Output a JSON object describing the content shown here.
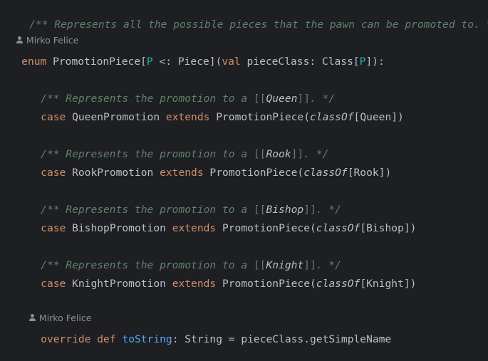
{
  "doc_top": "/** Represents all the possible pieces that the pawn can be promoted to. */",
  "author_1": "Mirko Felice",
  "enum_line": {
    "kw_enum": "enum",
    "name": " PromotionPiece[",
    "tparam": "P",
    "bound": " <: Piece](",
    "kw_val": "val",
    "rest": " pieceClass: Class[",
    "tparam2": "P",
    "end": "]):"
  },
  "cases": [
    {
      "doc_prefix": "/** Represents the promotion to a ",
      "doc_lb": "[[",
      "doc_link": "Queen",
      "doc_rb": "]]",
      "doc_suffix": ". */",
      "kw_case": "case",
      "name": " QueenPromotion ",
      "kw_extends": "extends",
      "parent": " PromotionPiece(",
      "fn": "classOf",
      "arg": "[Queen])"
    },
    {
      "doc_prefix": "/** Represents the promotion to a ",
      "doc_lb": "[[",
      "doc_link": "Rook",
      "doc_rb": "]]",
      "doc_suffix": ". */",
      "kw_case": "case",
      "name": " RookPromotion ",
      "kw_extends": "extends",
      "parent": " PromotionPiece(",
      "fn": "classOf",
      "arg": "[Rook])"
    },
    {
      "doc_prefix": "/** Represents the promotion to a ",
      "doc_lb": "[[",
      "doc_link": "Bishop",
      "doc_rb": "]]",
      "doc_suffix": ". */",
      "kw_case": "case",
      "name": " BishopPromotion ",
      "kw_extends": "extends",
      "parent": " PromotionPiece(",
      "fn": "classOf",
      "arg": "[Bishop])"
    },
    {
      "doc_prefix": "/** Represents the promotion to a ",
      "doc_lb": "[[",
      "doc_link": "Knight",
      "doc_rb": "]]",
      "doc_suffix": ". */",
      "kw_case": "case",
      "name": " KnightPromotion ",
      "kw_extends": "extends",
      "parent": " PromotionPiece(",
      "fn": "classOf",
      "arg": "[Knight])"
    }
  ],
  "author_2": "Mirko Felice",
  "override_line": {
    "kw_override": "override",
    "kw_def": "def",
    "fn": "toString",
    "rest": ": String = pieceClass.getSimpleName"
  },
  "colors": {
    "background": "#1e1f22",
    "doc_comment": "#5f826b",
    "keyword": "#cf8e6d",
    "type_param": "#16baac",
    "function": "#56a8f5",
    "text": "#bcbec4",
    "author_hint": "#8c8f95"
  }
}
